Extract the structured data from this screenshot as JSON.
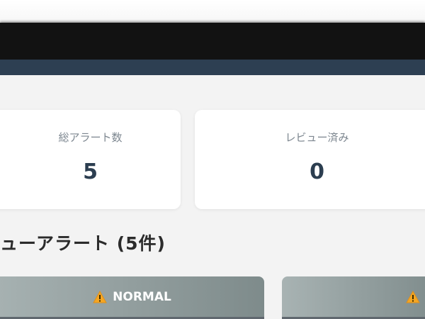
{
  "stats": {
    "total_label": "総アラート数",
    "total_value": "5",
    "reviewed_label": "レビュー済み",
    "reviewed_value": "0"
  },
  "section": {
    "title": "ューアラート (5件)"
  },
  "alerts": [
    {
      "severity": "NORMAL",
      "icon": "warning-icon"
    },
    {
      "severity": "",
      "icon": "warning-icon"
    }
  ],
  "colors": {
    "nav": "#2d3f52",
    "header_bar": "#121212",
    "alert_header": "#8e9a9a",
    "warning": "#f5a623",
    "stat_value": "#2c3e50"
  }
}
